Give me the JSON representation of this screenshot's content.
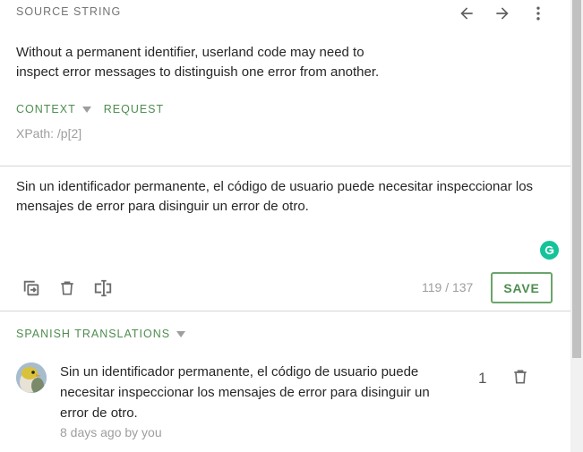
{
  "source": {
    "label": "SOURCE STRING",
    "text": "Without a permanent identifier, userland code may need to inspect error messages to distinguish one error from another.",
    "context_label": "CONTEXT",
    "request_label": "REQUEST",
    "xpath": "XPath: /p[2]"
  },
  "nav": {
    "prev_icon": "arrow-left-icon",
    "next_icon": "arrow-right-icon",
    "menu_icon": "more-vert-icon"
  },
  "editor": {
    "translation": "Sin un identificador permanente, el código de usuario puede necesitar inspeccionar los mensajes de error para disinguir un error de otro.",
    "counter": "119 / 137",
    "save_label": "SAVE",
    "tools": [
      "copy-source-icon",
      "delete-icon",
      "rtl-icon"
    ]
  },
  "suggestions": {
    "label": "SPANISH TRANSLATIONS",
    "items": [
      {
        "text": "Sin un identificador permanente, el código de usuario puede necesitar inspeccionar los mensajes de error para disinguir un error de otro.",
        "meta": "8 days ago by you",
        "votes": "1"
      }
    ]
  },
  "colors": {
    "accent": "#4d8d4f",
    "grammarly": "#15c39a"
  }
}
